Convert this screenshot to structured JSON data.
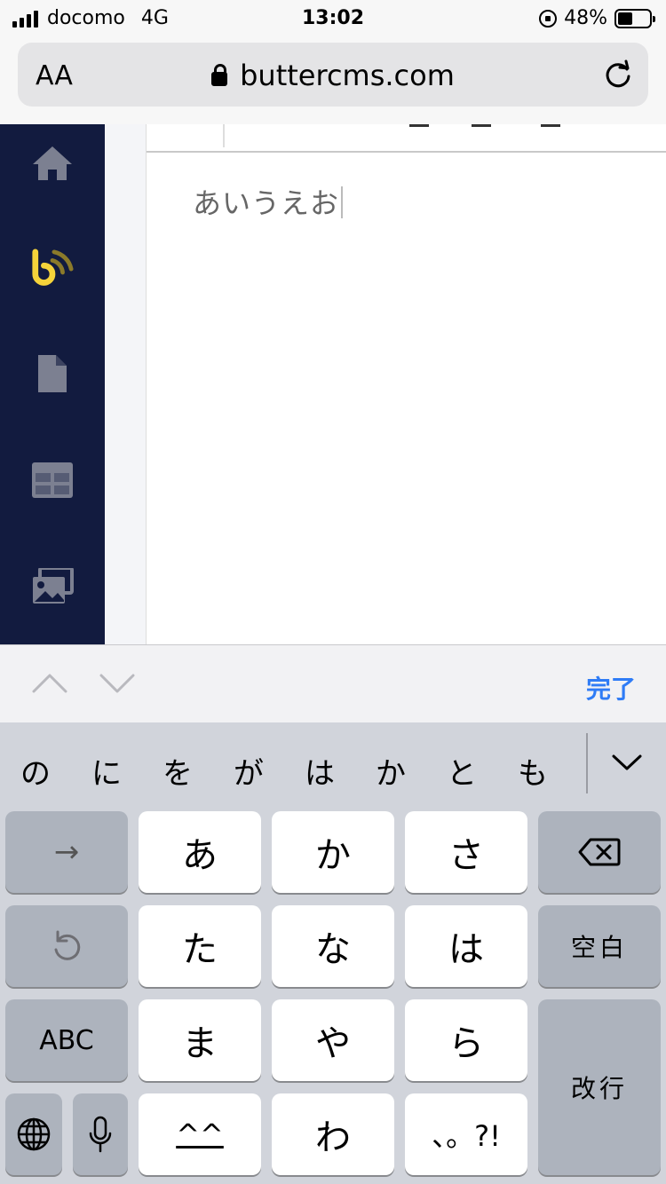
{
  "status_bar": {
    "carrier": "docomo",
    "network": "4G",
    "time": "13:02",
    "battery_percent": "48%",
    "battery_level": 0.48
  },
  "browser": {
    "text_size_button": "AA",
    "url": "buttercms.com"
  },
  "sidebar": {
    "items": [
      {
        "icon": "home-icon"
      },
      {
        "icon": "butter-logo-icon"
      },
      {
        "icon": "page-icon"
      },
      {
        "icon": "collections-icon"
      },
      {
        "icon": "media-icon"
      }
    ]
  },
  "editor": {
    "content": "あいうえお"
  },
  "accessory_bar": {
    "done_label": "完了"
  },
  "candidates": [
    "の",
    "に",
    "を",
    "が",
    "は",
    "か",
    "と",
    "も"
  ],
  "keyboard": {
    "next_key": "→",
    "keys": [
      "あ",
      "か",
      "さ",
      "た",
      "な",
      "は",
      "ま",
      "や",
      "ら",
      "^^",
      "わ",
      "、。?!"
    ],
    "space_label": "空白",
    "abc_label": "ABC",
    "return_label": "改行"
  },
  "colors": {
    "sidebar_bg": "#121b3f",
    "accent_link": "#2f7cf6",
    "butter_yellow": "#f5d33a",
    "butter_gold": "#8b7a2a"
  }
}
